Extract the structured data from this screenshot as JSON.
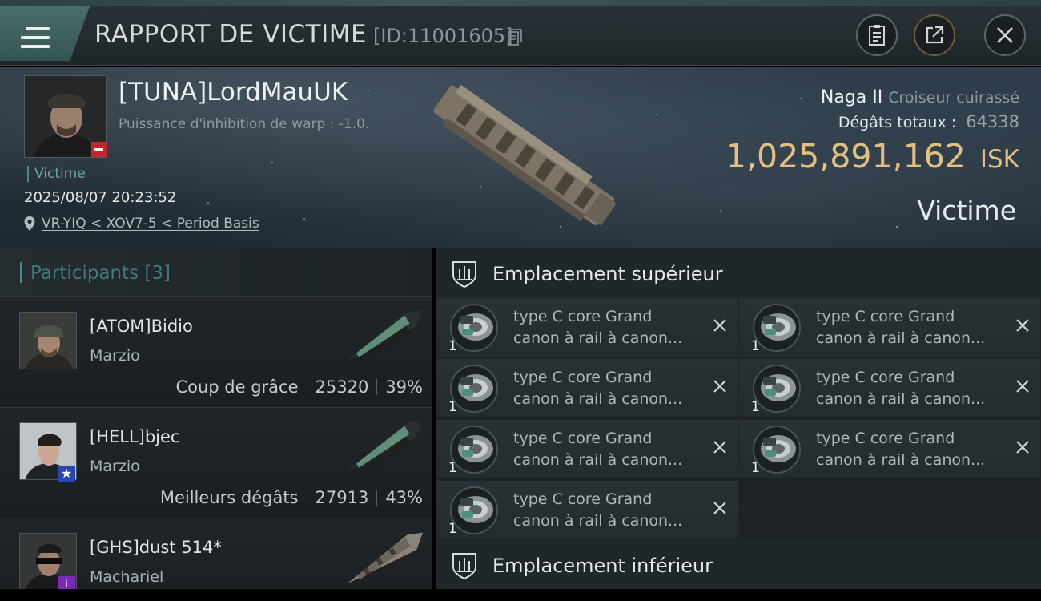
{
  "header": {
    "title": "RAPPORT DE VICTIME",
    "report_id": "[ID:11001605]",
    "icons": {
      "menu": "menu-icon",
      "copy": "copy-icon",
      "clipboard": "clipboard-icon",
      "share": "share-icon",
      "close": "close-icon"
    }
  },
  "victim": {
    "name": "[TUNA]LordMauUK",
    "warp": "Puissance d'inhibition de warp : -1.0.",
    "tag": "Victime",
    "datetime": "2025/08/07 20:23:52",
    "location": "VR-YIQ < XOV7-5 < Period Basis",
    "ship": "Naga II",
    "ship_class": "Croiseur cuirassé",
    "damage_label": "Dégâts totaux :",
    "damage_value": "64338",
    "isk_value": "1,025,891,162",
    "isk_currency": "ISK",
    "role_label": "Victime"
  },
  "participants": {
    "label": "Participants",
    "count": "[3]",
    "items": [
      {
        "name": "[ATOM]Bidio",
        "ship": "Marzio",
        "stat_label": "Coup de grâce",
        "damage": "25320",
        "percent": "39%"
      },
      {
        "name": "[HELL]bjec",
        "ship": "Marzio",
        "stat_label": "Meilleurs dégâts",
        "damage": "27913",
        "percent": "43%"
      },
      {
        "name": "[GHS]dust 514*",
        "ship": "Machariel",
        "stat_label": "",
        "damage": "",
        "percent": ""
      }
    ]
  },
  "fitting": {
    "high_slot_title": "Emplacement supérieur",
    "low_slot_title": "Emplacement inférieur",
    "slots": [
      {
        "line1": "type C core Grand",
        "line2": "canon à rail à canon...",
        "qty": "1"
      },
      {
        "line1": "type C core Grand",
        "line2": "canon à rail à canon...",
        "qty": "1"
      },
      {
        "line1": "type C core Grand",
        "line2": "canon à rail à canon...",
        "qty": "1"
      },
      {
        "line1": "type C core Grand",
        "line2": "canon à rail à canon...",
        "qty": "1"
      },
      {
        "line1": "type C core Grand",
        "line2": "canon à rail à canon...",
        "qty": "1"
      },
      {
        "line1": "type C core Grand",
        "line2": "canon à rail à canon...",
        "qty": "1"
      },
      {
        "line1": "type C core Grand",
        "line2": "canon à rail à canon...",
        "qty": "1"
      }
    ]
  },
  "colors": {
    "accent_teal": "#3f8d87",
    "isk_gold": "#e4c07f",
    "corp_red": "#c0262b"
  }
}
